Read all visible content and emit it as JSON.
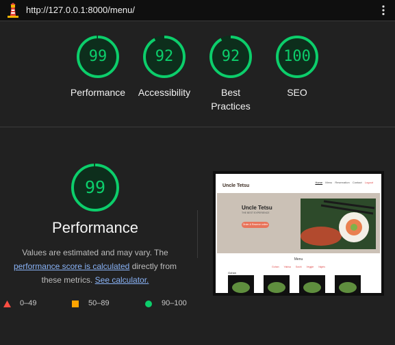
{
  "address_bar": {
    "url": "http://127.0.0.1:8000/menu/"
  },
  "icons": {
    "logo": "lighthouse-icon",
    "menu": "vertical-dots-menu-icon"
  },
  "colors": {
    "pass": "#0cce6b",
    "average": "#ffa400",
    "fail": "#ff4e42",
    "background": "#212121",
    "link": "#8ab4f8"
  },
  "categories": [
    {
      "score": "99",
      "label": "Performance",
      "fraction": 0.99
    },
    {
      "score": "92",
      "label": "Accessibility",
      "fraction": 0.92
    },
    {
      "score": "92",
      "label": "Best Practices",
      "fraction": 0.92
    },
    {
      "score": "100",
      "label": "SEO",
      "fraction": 1.0
    }
  ],
  "performance": {
    "score": "99",
    "fraction": 0.99,
    "title": "Performance",
    "desc_prefix": "Values are estimated and may vary. The",
    "desc_link": "performance score is calculated",
    "desc_mid": "directly from",
    "desc_suffix": "these metrics.",
    "calc_link": "See calculator."
  },
  "legend": [
    {
      "shape": "triangle",
      "label": "0–49"
    },
    {
      "shape": "square",
      "label": "50–89"
    },
    {
      "shape": "circle",
      "label": "90–100"
    }
  ],
  "screenshot": {
    "brand": "Uncle Tetsu",
    "nav": [
      "Home",
      "Menu",
      "Reservation",
      "Contact",
      "Logout"
    ],
    "hero_title": "Uncle Tetsu",
    "hero_subtitle": "THE BEST EXPERIENCE",
    "hero_button": "Order & Reserve online",
    "menu_title": "Menu",
    "menu_categories": [
      "Gohan",
      "Yakisa",
      "Sushi",
      "Veggie",
      "Nigiris"
    ],
    "section": "Gohan"
  }
}
